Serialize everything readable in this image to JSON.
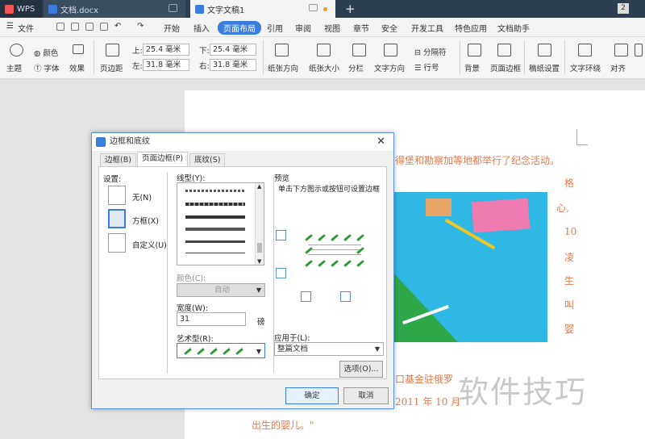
{
  "tabs": {
    "wps": "WPS",
    "doc1": "文档.docx",
    "doc2": "文字文稿1"
  },
  "window_badge": "2",
  "menu": [
    "文件",
    "开始",
    "插入",
    "页面布局",
    "引用",
    "审阅",
    "视图",
    "章节",
    "安全",
    "开发工具",
    "特色应用",
    "文档助手"
  ],
  "toolbar": {
    "theme": "主题",
    "color": "颜色",
    "font": "字体",
    "effect": "效果",
    "margin": "页边距",
    "top_label": "上:",
    "top_val": "25.4 毫米",
    "bottom_label": "下:",
    "bottom_val": "25.4 毫米",
    "left_label": "左:",
    "left_val": "31.8 毫米",
    "right_label": "右:",
    "right_val": "31.8 毫米",
    "orientation": "纸张方向",
    "size": "纸张大小",
    "columns": "分栏",
    "text_dir": "文字方向",
    "breaks": "分隔符",
    "line_num": "行号",
    "background": "背景",
    "page_border": "页面边框",
    "grid_paper": "稿纸设置",
    "wrap": "文字环绕",
    "align": "对齐"
  },
  "document": {
    "line1": "得堡和勘察加等地都举行了纪念活动。",
    "side_col": [
      "格",
      "心,",
      "10",
      "凌",
      "生",
      "叫",
      "婴"
    ],
    "line_fund": "口基金驻俄罗",
    "line_2011": "2011 年 10 月",
    "line_last": "出生的婴儿。\""
  },
  "dialog": {
    "title": "边框和底纹",
    "tabs": [
      "边框(B)",
      "页面边框(P)",
      "底纹(S)"
    ],
    "settings_label": "设置:",
    "settings": [
      "无(N)",
      "方框(X)",
      "自定义(U)"
    ],
    "style_label": "线型(Y):",
    "color_label": "颜色(C):",
    "color_value": "自动",
    "width_label": "宽度(W):",
    "width_value": "31",
    "width_unit": "磅",
    "art_label": "艺术型(R):",
    "preview_label": "预览",
    "preview_hint": "单击下方图示或按钮可设置边框",
    "apply_label": "应用于(L):",
    "apply_value": "整篇文档",
    "options_btn": "选项(O)...",
    "ok_btn": "确定",
    "cancel_btn": "取消"
  },
  "watermark": "软件技巧"
}
